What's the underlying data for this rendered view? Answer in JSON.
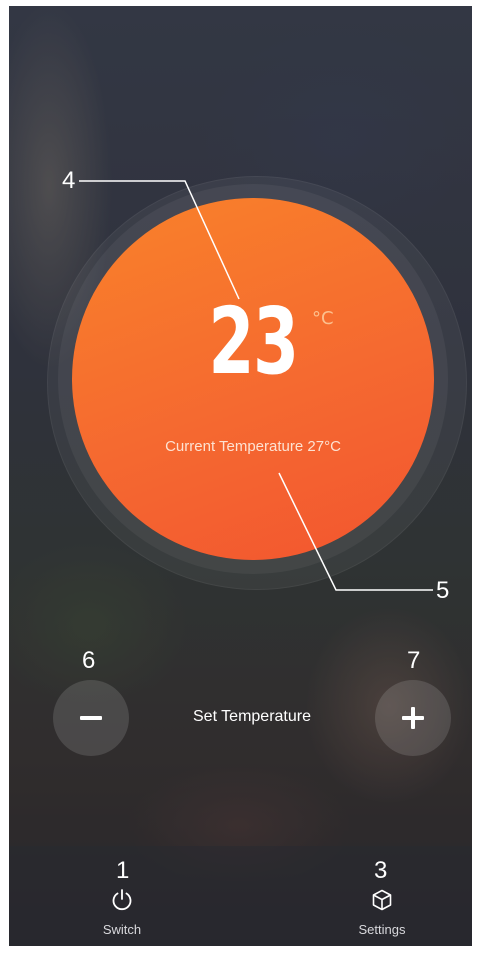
{
  "thermostat": {
    "set_value": "23",
    "unit": "°C",
    "current_label": "Current Temperature 27°C",
    "accent_color": "#f56930"
  },
  "controls": {
    "set_label": "Set Temperature",
    "minus_icon": "minus-icon",
    "plus_icon": "plus-icon"
  },
  "bottom_bar": {
    "items": [
      {
        "label": "Switch",
        "icon": "power-icon"
      },
      {
        "label": "Settings",
        "icon": "cube-icon"
      }
    ]
  },
  "callouts": {
    "switch": "1",
    "settings": "3",
    "set_value": "4",
    "current_temp": "5",
    "minus": "6",
    "plus": "7"
  }
}
